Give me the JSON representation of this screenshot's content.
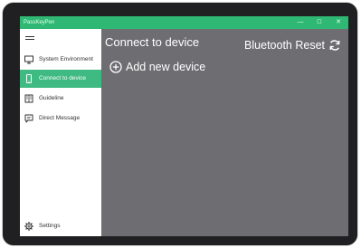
{
  "window": {
    "title": "PassKeyPen",
    "minimize_glyph": "—",
    "maximize_glyph": "☐",
    "close_glyph": "✕"
  },
  "sidebar": {
    "menu_icon": "hamburger-icon",
    "items": [
      {
        "label": "System Environment",
        "icon": "monitor-icon",
        "active": false
      },
      {
        "label": "Connect to device",
        "icon": "phone-icon",
        "active": true
      },
      {
        "label": "Guideline",
        "icon": "book-icon",
        "active": false
      },
      {
        "label": "Direct Message",
        "icon": "chat-icon",
        "active": false
      }
    ],
    "settings": {
      "label": "Settings",
      "icon": "gear-icon"
    }
  },
  "main": {
    "title": "Connect to device",
    "bluetooth_reset": {
      "label": "Bluetooth Reset",
      "icon": "refresh-icon"
    },
    "add_device": {
      "label": "Add new device",
      "icon": "plus-circle-icon"
    }
  },
  "colors": {
    "accent": "#3fba82",
    "titlebar": "#2fb874",
    "content_bg": "#6e6e72",
    "bezel": "#202022"
  }
}
